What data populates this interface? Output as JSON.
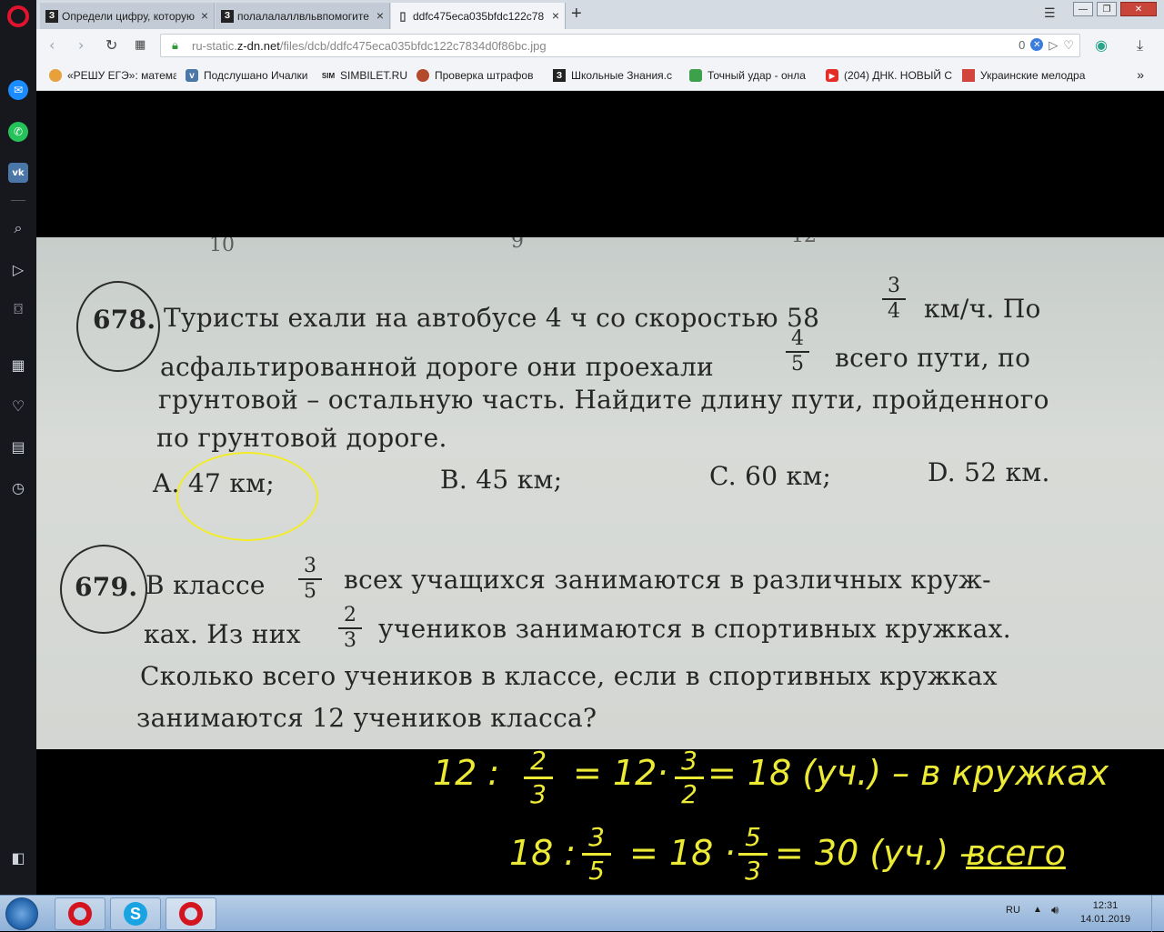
{
  "browser": {
    "tabs": [
      {
        "icon": "З",
        "title": "Определи цифру, которую",
        "active": false
      },
      {
        "icon": "З",
        "title": "полалалаллвльвпомогите",
        "active": false
      },
      {
        "icon": "doc",
        "title": "ddfc475eca035bfdc122c78",
        "active": true
      }
    ],
    "url": {
      "prefix": "ru-static.",
      "domain": "z-dn.net",
      "path": "/files/dcb/ddfc475eca035bfdc122c7834d0f86bc.jpg",
      "badge_count": "0"
    },
    "bookmarks": [
      {
        "icon": "reshu-icon",
        "label": "«РЕШУ ЕГЭ»: матема"
      },
      {
        "icon": "vk-icon",
        "label": "Подслушано Ичалки"
      },
      {
        "icon": "sim-icon",
        "label": "SIMBILET.RU"
      },
      {
        "icon": "police-icon",
        "label": "Проверка штрафов"
      },
      {
        "icon": "znania-icon",
        "label": "Школьные Знания.с"
      },
      {
        "icon": "game-icon",
        "label": "Точный удар - онла"
      },
      {
        "icon": "youtube-icon",
        "label": "(204) ДНК. НОВЫЙ С"
      },
      {
        "icon": "music-icon",
        "label": "Украинские мелодра"
      }
    ],
    "bookmarks_more": "»"
  },
  "photo": {
    "faded_top": [
      "10",
      "9",
      "12"
    ],
    "problem_678": {
      "number": "678.",
      "line1_a": "Туристы ехали на автобусе 4 ч со скоростью 58",
      "line1_b": "км/ч. По",
      "mixed_num": "3",
      "mixed_den": "4",
      "line2_a": "асфальтированной дороге они проехали",
      "line2_b": "всего пути, по",
      "frac_num": "4",
      "frac_den": "5",
      "line3": "грунтовой – остальную часть. Найдите длину пути, пройденного",
      "line4": "по грунтовой дороге.",
      "options": [
        "A. 47 км;",
        "B. 45 км;",
        "C. 60 км;",
        "D. 52 км."
      ]
    },
    "problem_679": {
      "number": "679.",
      "line1_a": "В классе",
      "line1_b": "всех учащихся занимаются в различных круж-",
      "frac1_num": "3",
      "frac1_den": "5",
      "line2_a": "ках. Из них",
      "line2_b": "учеников занимаются в спортивных кружках.",
      "frac2_num": "2",
      "frac2_den": "3",
      "line3": "Сколько всего учеников в классе, если в спортивных кружках",
      "line4": "занимаются 12 учеников класса?"
    }
  },
  "solution": {
    "line1": {
      "a": "12 :",
      "f1_num": "2",
      "f1_den": "3",
      "b": "= 12·",
      "f2_num": "3",
      "f2_den": "2",
      "c": "= 18 (уч.) – в кружках"
    },
    "line2": {
      "a": "18 :",
      "f1_num": "3",
      "f1_den": "5",
      "b": "= 18 ·",
      "f2_num": "5",
      "f2_den": "3",
      "c": "= 30 (уч.) –",
      "d": "всего"
    }
  },
  "taskbar": {
    "lang": "RU",
    "time": "12:31",
    "date": "14.01.2019"
  }
}
